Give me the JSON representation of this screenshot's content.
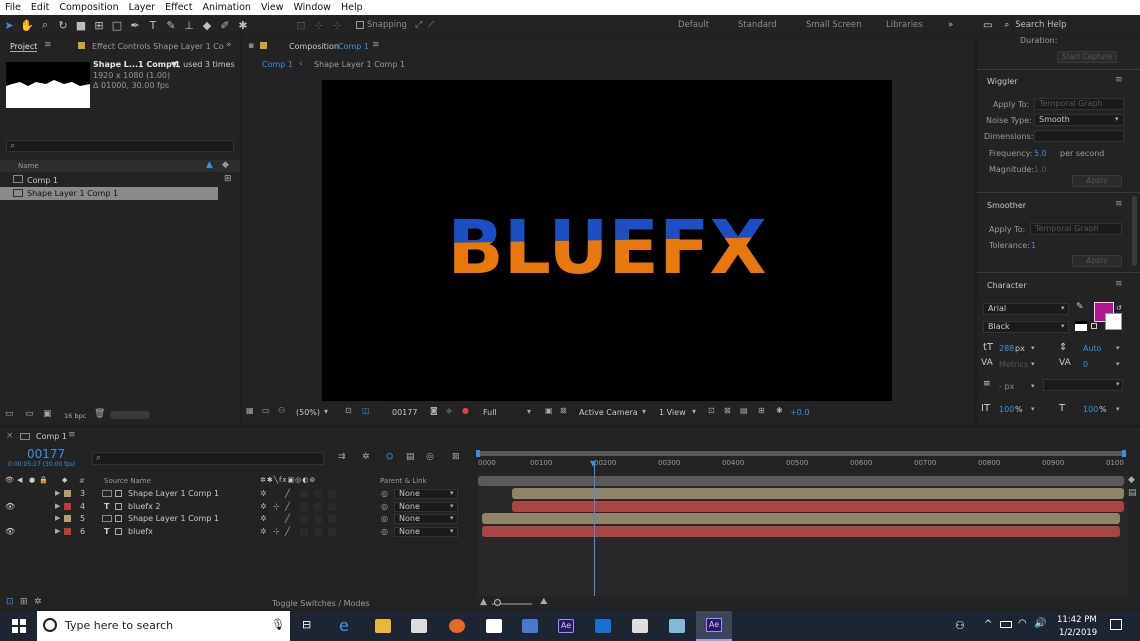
{
  "menu": [
    "File",
    "Edit",
    "Composition",
    "Layer",
    "Effect",
    "Animation",
    "View",
    "Window",
    "Help"
  ],
  "toolbar": {
    "snapping": "Snapping",
    "workspaces": [
      "Default",
      "Standard",
      "Small Screen",
      "Libraries"
    ],
    "search_help": "Search Help"
  },
  "project": {
    "tab": "Project",
    "effect_tab": "Effect Controls Shape Layer 1 Co",
    "item_name": "Shape L...1 Comp 1",
    "used": ", used 3 times",
    "dims": "1920 x 1080 (1.00)",
    "duration": "Δ 01000, 30.00 fps",
    "col_name": "Name",
    "items": [
      "Comp 1",
      "Shape Layer 1 Comp 1"
    ],
    "bpc": "16 bpc"
  },
  "composition": {
    "tab_prefix": "Composition",
    "tab_name": "Comp 1",
    "crumbs": [
      "Comp 1",
      "Shape Layer 1 Comp 1"
    ],
    "text": "BLUEFX",
    "top_color": "#1d4fc4",
    "bottom_color": "#e8780c",
    "zoom": "(50%)",
    "timecode": "00177",
    "resolution": "Full",
    "camera": "Active Camera",
    "views": "1 View",
    "exposure": "+0.0"
  },
  "right": {
    "duration_label": "Duration:",
    "start_capture": "Start Capture",
    "wiggler": {
      "title": "Wiggler",
      "apply_to_label": "Apply To:",
      "apply_to": "Temporal Graph",
      "noise_label": "Noise Type:",
      "noise": "Smooth",
      "dimensions_label": "Dimensions:",
      "frequency_label": "Frequency:",
      "frequency": "5.0",
      "frequency_unit": "per second",
      "magnitude_label": "Magnitude:",
      "magnitude": "1.0",
      "apply": "Apply"
    },
    "smoother": {
      "title": "Smoother",
      "apply_to_label": "Apply To:",
      "apply_to": "Temporal Graph",
      "tolerance_label": "Tolerance:",
      "tolerance": "1",
      "apply": "Apply"
    },
    "character": {
      "title": "Character",
      "font": "Arial",
      "style": "Black",
      "size": "288",
      "size_unit": "px",
      "leading": "Auto",
      "kerning": "Metrics",
      "tracking": "0",
      "indent_unit": "- px",
      "vscale": "100",
      "hscale": "100",
      "pct": "%",
      "fill_color": "#b0168f"
    }
  },
  "timeline": {
    "tab": "Comp 1",
    "timecode": "00177",
    "timecode_sub": "0:00:05:27 (30.00 fps)",
    "col_source": "Source Name",
    "col_parent": "Parent & Link",
    "col_num": "#",
    "ruler": [
      "0000",
      "00100",
      "00200",
      "00300",
      "00400",
      "00500",
      "00600",
      "00700",
      "00800",
      "00900",
      "0100"
    ],
    "layers": [
      {
        "num": "3",
        "name": "Shape Layer 1 Comp 1",
        "parent": "None",
        "label": "#b3a070",
        "eye": false,
        "type": "comp"
      },
      {
        "num": "4",
        "name": "bluefx 2",
        "parent": "None",
        "label": "#c03a3a",
        "eye": true,
        "type": "text"
      },
      {
        "num": "5",
        "name": "Shape Layer 1 Comp 1",
        "parent": "None",
        "label": "#b3a070",
        "eye": false,
        "type": "comp"
      },
      {
        "num": "6",
        "name": "bluefx",
        "parent": "None",
        "label": "#c03a3a",
        "eye": true,
        "type": "text"
      }
    ],
    "toggle": "Toggle Switches / Modes"
  },
  "taskbar": {
    "search": "Type here to search",
    "time": "11:42 PM",
    "date": "1/2/2019"
  }
}
